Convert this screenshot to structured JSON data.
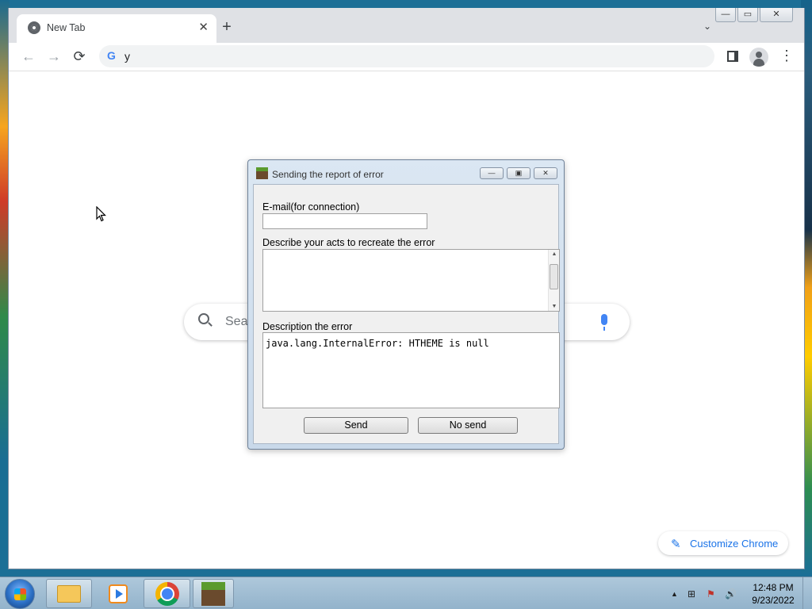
{
  "browser": {
    "tab_title": "New Tab",
    "tab_close": "✕",
    "new_tab": "+",
    "tab_search": "⌄",
    "window_buttons": {
      "minimize": "—",
      "maximize": "▭",
      "close": "✕"
    },
    "omnibox_text": "y",
    "omnibox_engine": "G",
    "menu": "⋮",
    "nav": {
      "back": "←",
      "forward": "→",
      "reload": "⟳"
    }
  },
  "ntp": {
    "search_placeholder": "Sear",
    "customize_label": "Customize Chrome",
    "customize_icon": "✎"
  },
  "dialog": {
    "title": "Sending the report of error",
    "window_buttons": {
      "minimize": "—",
      "maximize": "▣",
      "close": "✕"
    },
    "email_label": "E-mail(for connection)",
    "email_value": "",
    "describe_label": "Describe your acts to recreate the error",
    "describe_value": "",
    "description_label": "Description the error",
    "error_text": "java.lang.InternalError: HTHEME is null",
    "send_label": "Send",
    "no_send_label": "No send"
  },
  "taskbar": {
    "clock_time": "12:48 PM",
    "clock_date": "9/23/2022",
    "tray": {
      "expand": "▲",
      "network": "⊞",
      "flag": "⚑",
      "volume": "🔊"
    }
  },
  "colors": {
    "accent": "#1a73e8",
    "dialog_bg": "#dbe7f3",
    "taskbar": "#aec8db"
  }
}
